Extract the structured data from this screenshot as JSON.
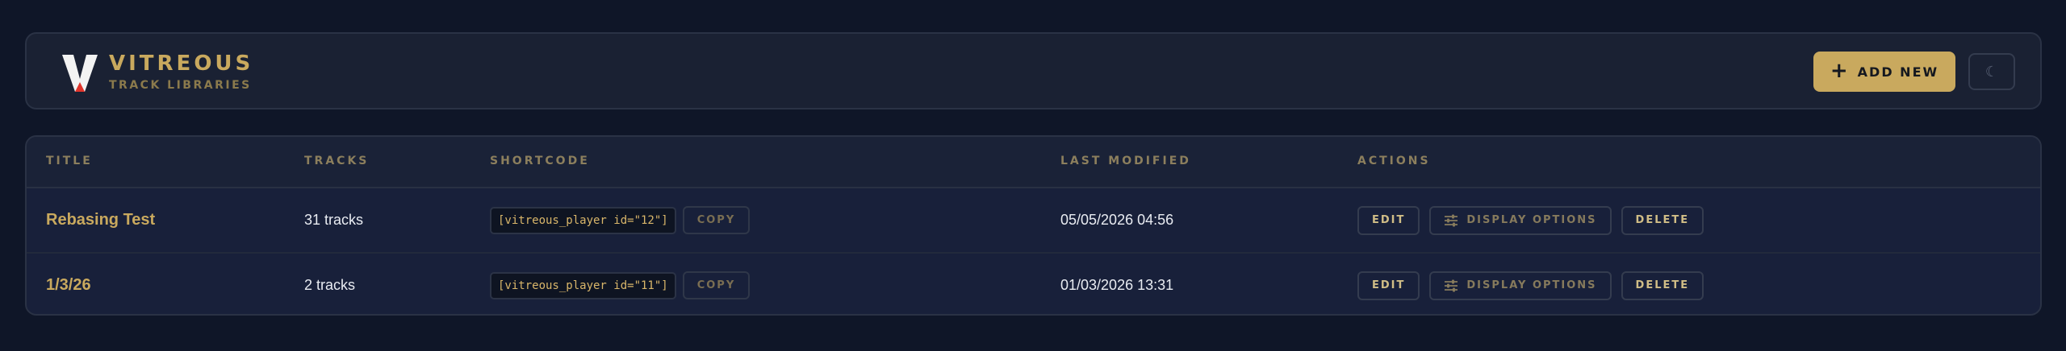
{
  "header": {
    "app_name": "VITREOUS",
    "subtitle": "TRACK LIBRARIES",
    "add_new_label": "ADD NEW",
    "theme_toggle_glyph": "☾",
    "brand_color": "#c9a95e"
  },
  "table": {
    "columns": [
      "TITLE",
      "TRACKS",
      "SHORTCODE",
      "LAST MODIFIED",
      "ACTIONS"
    ],
    "rows": [
      {
        "title": "Rebasing Test",
        "tracks": "31 tracks",
        "shortcode": "[vitreous_player id=\"12\"]",
        "copy_label": "COPY",
        "last_modified": "05/05/2026 04:56",
        "edit_label": "EDIT",
        "display_options_label": "DISPLAY OPTIONS",
        "delete_label": "DELETE"
      },
      {
        "title": "1/3/26",
        "tracks": "2 tracks",
        "shortcode": "[vitreous_player id=\"11\"]",
        "copy_label": "COPY",
        "last_modified": "01/03/2026 13:31",
        "edit_label": "EDIT",
        "display_options_label": "DISPLAY OPTIONS",
        "delete_label": "DELETE"
      }
    ]
  },
  "icons": {
    "logo": "vitreous-v-logo",
    "add": "plus-icon",
    "theme": "moon-icon",
    "display_options": "sliders-icon"
  }
}
